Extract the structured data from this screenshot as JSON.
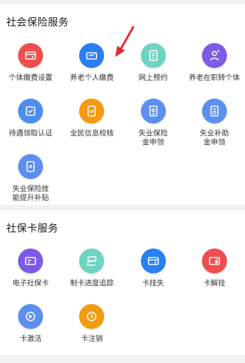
{
  "social_security": {
    "title": "社会保险服务",
    "items": [
      {
        "label": "个体缴费设置",
        "icon": "payment-card-icon",
        "color": "#ef4e4e"
      },
      {
        "label": "养老个人缴费",
        "icon": "pension-card-icon",
        "color": "#2a7ff2"
      },
      {
        "label": "网上预约",
        "icon": "appointment-icon",
        "color": "#6fd3c4"
      },
      {
        "label": "养老在职转个体",
        "icon": "transfer-person-icon",
        "color": "#7c5ce6"
      },
      {
        "label": "待遇领取认证",
        "icon": "certification-icon",
        "color": "#4e8df0"
      },
      {
        "label": "全民信息校核",
        "icon": "info-check-icon",
        "color": "#f39a11"
      },
      {
        "label": "失业保险\n金申领",
        "icon": "unemployment-claim-icon",
        "color": "#5d8ff0"
      },
      {
        "label": "失业补助\n金申领",
        "icon": "subsidy-claim-icon",
        "color": "#5d8ff0"
      },
      {
        "label": "失业保险技\n能提升补贴",
        "icon": "skill-subsidy-icon",
        "color": "#5d8ff0"
      }
    ]
  },
  "social_card": {
    "title": "社保卡服务",
    "items": [
      {
        "label": "电子社保卡",
        "icon": "e-card-icon",
        "color": "#7c5ce6"
      },
      {
        "label": "制卡进度追踪",
        "icon": "card-progress-icon",
        "color": "#6fd3c4"
      },
      {
        "label": "卡挂失",
        "icon": "card-loss-icon",
        "color": "#2a7ff2"
      },
      {
        "label": "卡解挂",
        "icon": "card-unlock-icon",
        "color": "#ef4e4e"
      },
      {
        "label": "卡激活",
        "icon": "card-activate-icon",
        "color": "#5d8ff0"
      },
      {
        "label": "卡注销",
        "icon": "card-cancel-icon",
        "color": "#f39a11"
      }
    ]
  },
  "annotation": {
    "icon": "red-arrow-icon",
    "color": "#e8262d"
  }
}
